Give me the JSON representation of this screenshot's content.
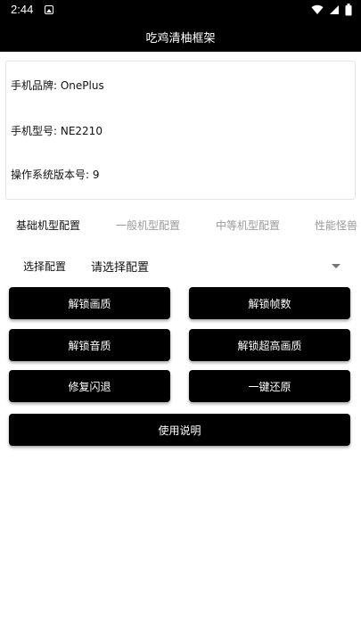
{
  "status_bar": {
    "time": "2:44",
    "icons": [
      "notification-icon",
      "wifi-icon",
      "cellular-icon",
      "battery-icon"
    ]
  },
  "app_bar": {
    "title": "吃鸡清柚框架"
  },
  "device_info": {
    "brand": "手机品牌: OnePlus",
    "model": "手机型号: NE2210",
    "os_version": "操作系统版本号: 9"
  },
  "tabs": [
    {
      "label": "基础机型配置",
      "active": true
    },
    {
      "label": "一般机型配置",
      "active": false
    },
    {
      "label": "中等机型配置",
      "active": false
    },
    {
      "label": "性能怪兽",
      "active": false
    }
  ],
  "config_select": {
    "label": "选择配置",
    "value": "请选择配置"
  },
  "buttons": {
    "unlock_quality": "解锁画质",
    "unlock_fps": "解锁帧数",
    "unlock_audio": "解锁音质",
    "unlock_ultra_hd": "解锁超高画质",
    "fix_crash": "修复闪退",
    "one_click_restore": "一键还原",
    "instructions": "使用说明"
  },
  "colors": {
    "bar_background": "#000000",
    "button_background": "#000000",
    "button_text": "#ffffff",
    "tab_active": "#111111",
    "tab_inactive": "#9a9a9a"
  }
}
